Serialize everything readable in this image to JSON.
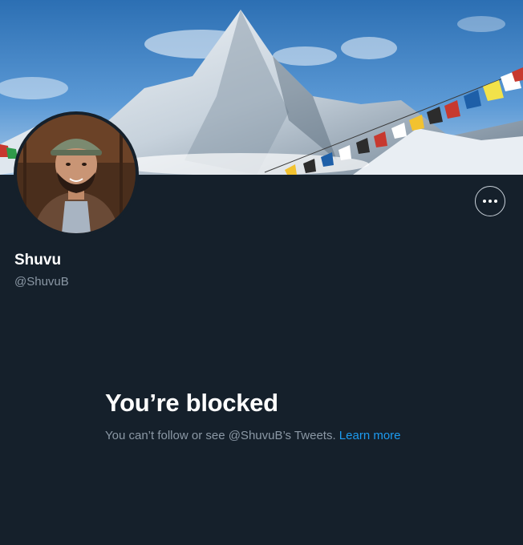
{
  "profile": {
    "display_name": "Shuvu",
    "handle": "@ShuvuB"
  },
  "actions": {
    "more_icon": "more-horizontal-icon"
  },
  "blocked": {
    "title": "You’re blocked",
    "message": "You can’t follow or see @ShuvuB’s Tweets.",
    "link_label": "Learn more"
  },
  "colors": {
    "background": "#15202b",
    "primary_text": "#ffffff",
    "secondary_text": "#8b98a5",
    "link": "#1d9bf0"
  }
}
